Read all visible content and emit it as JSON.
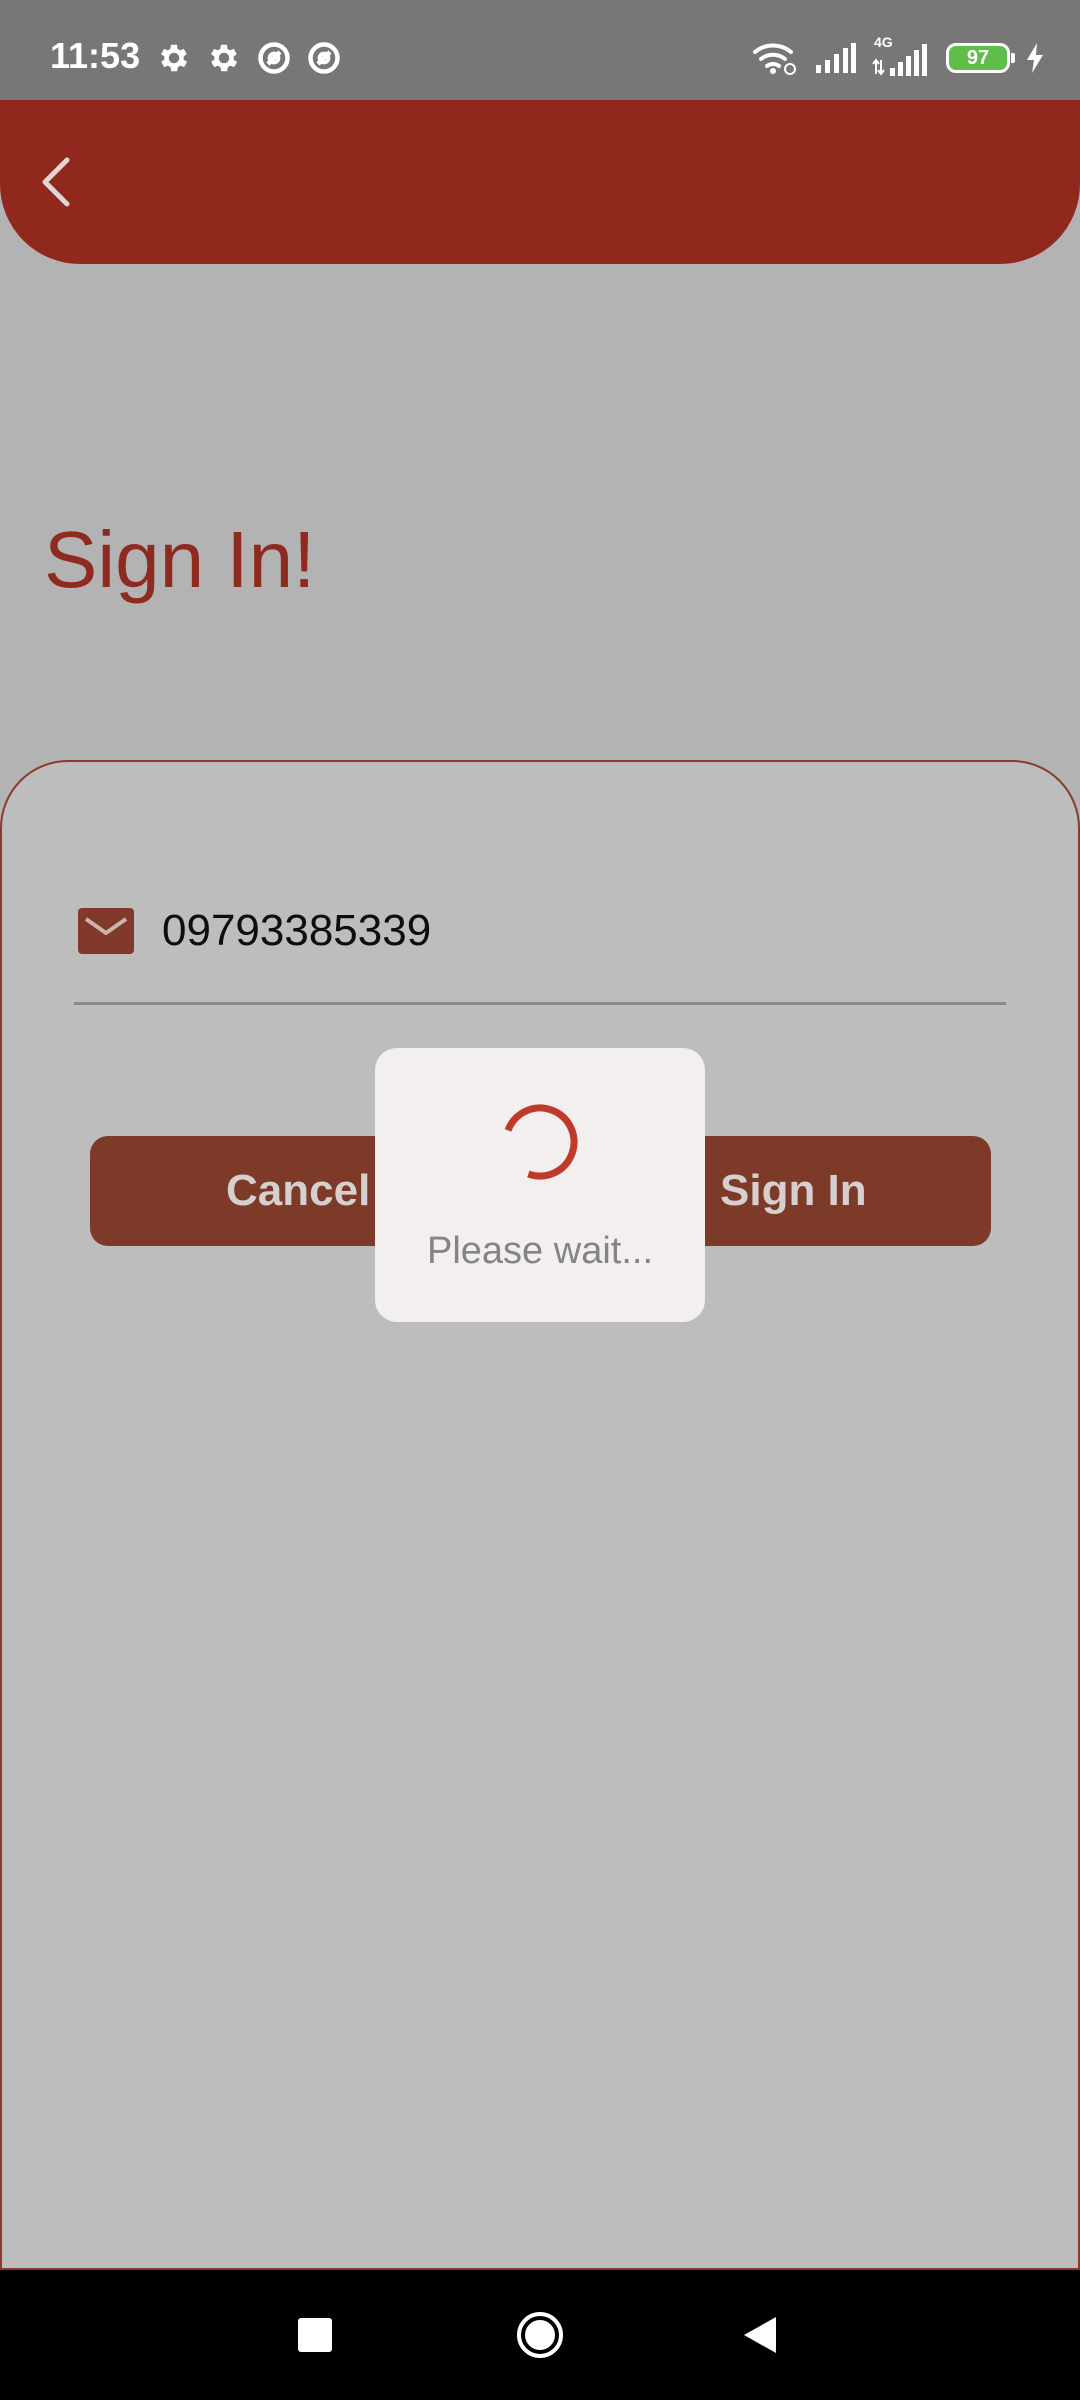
{
  "status_bar": {
    "time": "11:53",
    "battery_level": "97",
    "network_label": "4G",
    "icons": [
      "gear-icon",
      "gear-icon",
      "sync-icon",
      "sync-icon",
      "wifi-icon",
      "signal-icon",
      "signal-4g-icon",
      "battery-icon",
      "charging-icon"
    ]
  },
  "header": {
    "back_icon": "chevron-left-icon",
    "background_color": "#91281d"
  },
  "page": {
    "title": "Sign In!"
  },
  "form": {
    "phone_field": {
      "icon": "mail-icon",
      "value": "09793385339"
    },
    "cancel_label": "Cancel",
    "sign_in_label": "Sign In"
  },
  "loading_dialog": {
    "message": "Please wait...",
    "spinner_icon": "spinner-icon"
  },
  "nav_bar": {
    "icons": [
      "recents-icon",
      "home-icon",
      "back-icon"
    ]
  },
  "colors": {
    "accent": "#91281d",
    "button": "#7d3a28",
    "spinner": "#c0392b"
  }
}
